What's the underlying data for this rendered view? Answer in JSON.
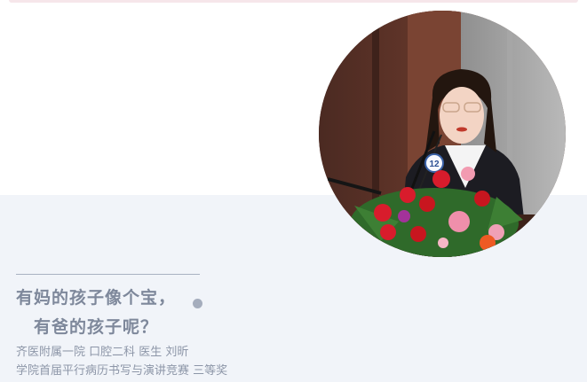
{
  "article": {
    "headline_line1": "有妈的孩子像个宝，",
    "headline_line2": "有爸的孩子呢？",
    "affiliation": "齐医附属一院 口腔二科 医生 刘昕",
    "award": "学院首届平行病历书写与演讲竞赛 三等奖",
    "badge_number": "12"
  },
  "colors": {
    "card_background": "#f1f4f9",
    "headline": "#7e889b",
    "meta_text": "#8d96a8",
    "accent_dot": "#a5adbd"
  }
}
